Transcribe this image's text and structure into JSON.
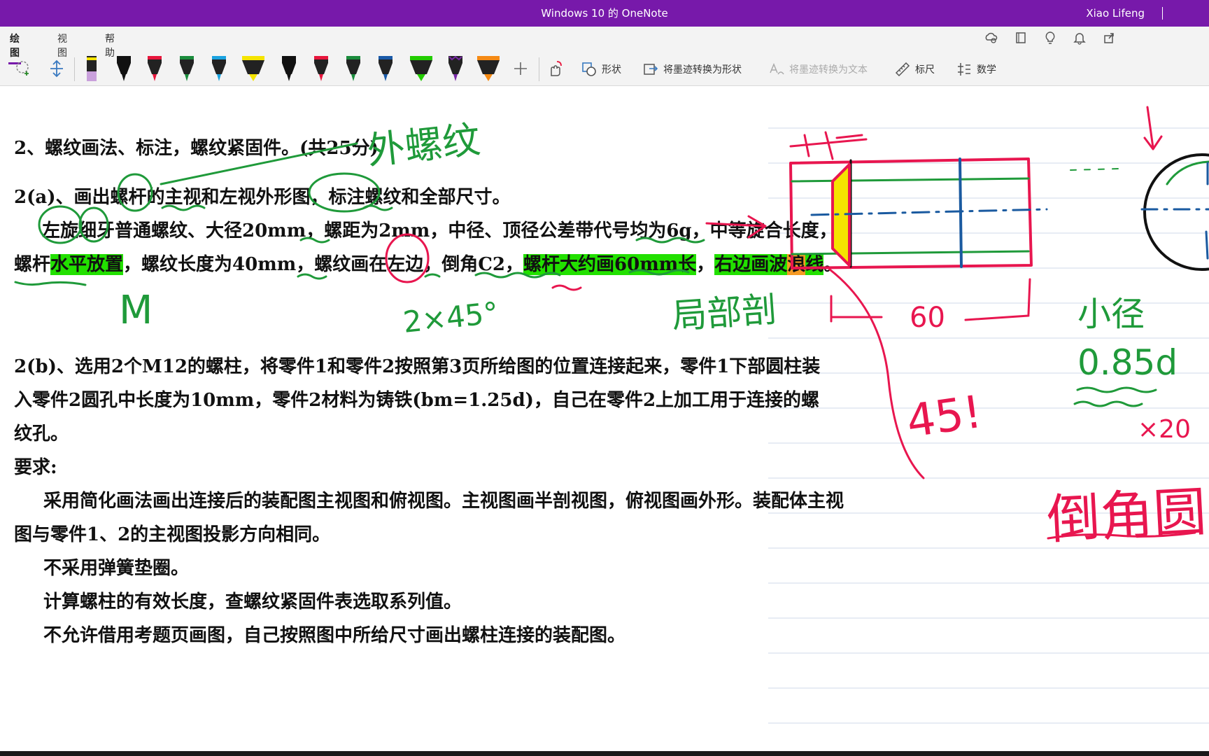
{
  "window": {
    "title": "Windows 10 的 OneNote",
    "user": "Xiao Lifeng"
  },
  "menu": {
    "items": [
      "绘图",
      "视图",
      "帮助"
    ],
    "active": "绘图"
  },
  "ribbon": {
    "shapes_label": "形状",
    "ink_to_shape_label": "将墨迹转换为形状",
    "ink_to_text_label": "将墨迹转换为文本",
    "ruler_label": "标尺",
    "math_label": "数学",
    "pen_colors": [
      "#111111",
      "#e8163c",
      "#1a8c3c",
      "#1aa3e0",
      "#f5e400",
      "#111111",
      "#e8163c",
      "#1a8c3c",
      "#1a5aa8",
      "#22cc00",
      "#7a2aa8",
      "#f58a14"
    ]
  },
  "content": {
    "line1": "2、螺纹画法、标注，螺纹紧固件。(共25分)",
    "line2": "2(a)、画出螺杆的主视和左视外形图，标注螺纹和全部尺寸。",
    "line3": "左旋细牙普通螺纹、大径20mm，螺距为2mm，中径、顶径公差带代号均为6g，中等旋合长度，",
    "line4_a": "螺杆",
    "line4_b": "水平放置",
    "line4_c": "，螺纹长度为40mm，螺纹画在左边，倒角C2，",
    "line4_d": "螺杆大约画60mm长",
    "line4_e": "，",
    "line4_f": "右边画波",
    "line4_g": "浪",
    "line4_h": "线",
    "line4_i": "。",
    "line5": "2(b)、选用2个M12的螺柱，将零件1和零件2按照第3页所给图的位置连接起来，零件1下部圆柱装",
    "line6": "入零件2圆孔中长度为10mm，零件2材料为铸铁(bm=1.25d)，自己在零件2上加工用于连接的螺",
    "line7": "纹孔。",
    "line8": "要求:",
    "line9": "采用简化画法画出连接后的装配图主视图和俯视图。主视图画半剖视图，俯视图画外形。装配体主视",
    "line10": "图与零件1、2的主视图投影方向相同。",
    "line11": "不采用弹簧垫圈。",
    "line12": "计算螺柱的有效长度，查螺纹紧固件表选取系列值。",
    "line13": "不允许借用考题页画图，自己按照图中所给尺寸画出螺柱连接的装配图。"
  },
  "ink": {
    "note_thread": "外螺纹",
    "note_m": "M",
    "note_chamfer": "2×45°",
    "note_section": "局部剖",
    "note_60": "60",
    "note_45": "45!",
    "note_085d": "0.85d",
    "note_x20": "×20",
    "note_small_dia": "小径",
    "note_chamfer_circle": "倒角圆",
    "colors": {
      "green": "#1f9a3a",
      "red": "#e8164f",
      "blue": "#1a5aa0",
      "black": "#111111",
      "yellow": "#f5e400"
    }
  }
}
